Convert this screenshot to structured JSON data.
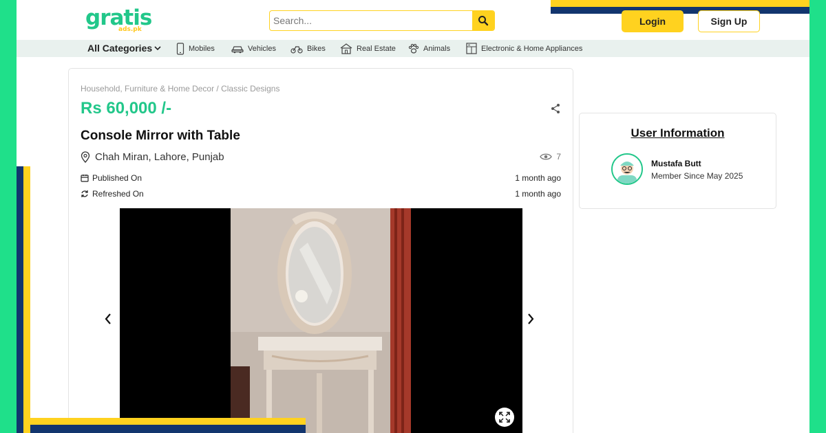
{
  "brand": {
    "logo_main": "gratis",
    "logo_sub": "ads.pk",
    "accent_green": "#22c78a",
    "accent_yellow": "#ffd21f",
    "stripe_blue": "#12356e"
  },
  "header": {
    "search_placeholder": "Search...",
    "search_icon": "search-icon",
    "login_label": "Login",
    "signup_label": "Sign Up"
  },
  "categories": {
    "all_label": "All Categories",
    "items": [
      {
        "label": "Mobiles",
        "icon": "mobile-icon"
      },
      {
        "label": "Vehicles",
        "icon": "car-icon"
      },
      {
        "label": "Bikes",
        "icon": "bike-icon"
      },
      {
        "label": "Real Estate",
        "icon": "building-icon"
      },
      {
        "label": "Animals",
        "icon": "paw-icon"
      },
      {
        "label": "Electronic & Home Appliances",
        "icon": "appliance-icon"
      }
    ]
  },
  "listing": {
    "breadcrumb": "Household, Furniture & Home Decor / Classic Designs",
    "price": "Rs 60,000 /-",
    "title": "Console Mirror with Table",
    "location": "Chah Miran, Lahore, Punjab",
    "views": "7",
    "published_label": "Published On",
    "published_value": "1 month ago",
    "refreshed_label": "Refreshed On",
    "refreshed_value": "1 month ago"
  },
  "user": {
    "heading": "User Information",
    "name": "Mustafa Butt",
    "member_since": "Member Since May 2025"
  }
}
